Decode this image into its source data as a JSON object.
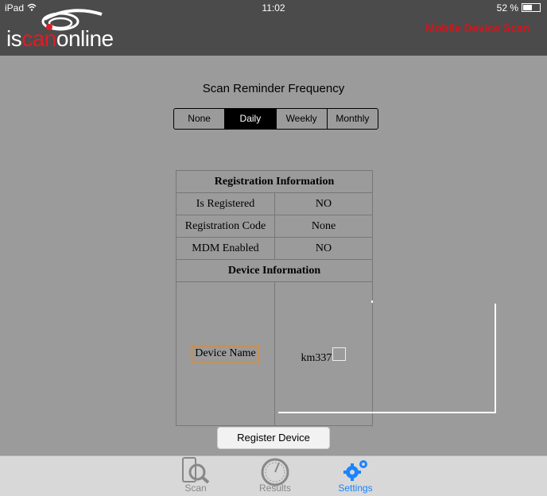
{
  "status": {
    "device": "iPad",
    "time": "11:02",
    "battery": "52 %",
    "battery_level": 0.52
  },
  "header": {
    "logo_text_gray1": "is",
    "logo_text_red": "can",
    "logo_text_gray2": "online",
    "title": "Mobile Device Scan",
    "title_color": "#d4141c"
  },
  "reminder": {
    "title": "Scan Reminder Frequency",
    "options": [
      "None",
      "Daily",
      "Weekly",
      "Monthly"
    ],
    "selected": "Daily"
  },
  "registration": {
    "header": "Registration Information",
    "rows": [
      {
        "label": "Is Registered",
        "value": "NO"
      },
      {
        "label": "Registration Code",
        "value": "None"
      },
      {
        "label": "MDM Enabled",
        "value": "NO"
      }
    ],
    "device_header": "Device Information",
    "device_name_label": "Device Name",
    "device_name_value": "km337"
  },
  "register_button": "Register Device",
  "tabs": [
    {
      "label": "Scan",
      "icon": "scan-icon",
      "active": false
    },
    {
      "label": "Results",
      "icon": "results-gauge-icon",
      "active": false
    },
    {
      "label": "Settings",
      "icon": "settings-gears-icon",
      "active": true
    }
  ],
  "colors": {
    "accent": "#1a84ff",
    "header_bg": "#4b4b4b",
    "body_bg": "#9b9b9b"
  }
}
